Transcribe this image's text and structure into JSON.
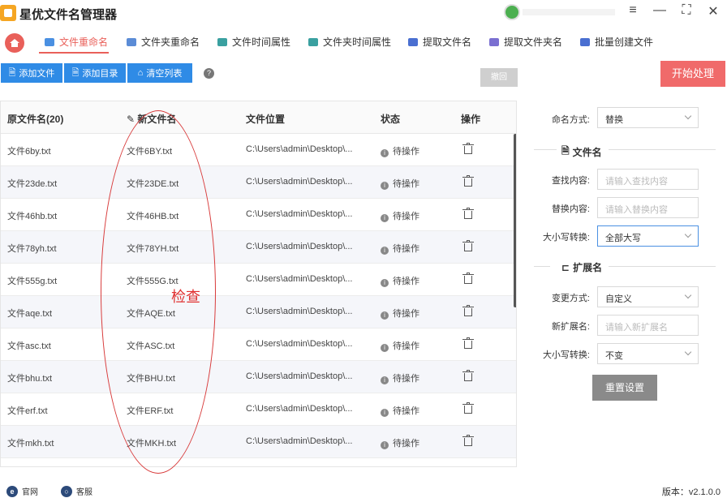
{
  "app": {
    "title": "星优文件名管理器"
  },
  "window": {
    "minimize": "—",
    "restore": "⛶",
    "close": "✕",
    "settings": "≡"
  },
  "tabs": [
    {
      "label": "文件重命名",
      "color": "#4a90e2"
    },
    {
      "label": "文件夹重命名",
      "color": "#5b8cd6"
    },
    {
      "label": "文件时间属性",
      "color": "#3aa0a0"
    },
    {
      "label": "文件夹时间属性",
      "color": "#3aa0a0"
    },
    {
      "label": "提取文件名",
      "color": "#4a6fd1"
    },
    {
      "label": "提取文件夹名",
      "color": "#7a6fd1"
    },
    {
      "label": "批量创建文件",
      "color": "#4a6fd1"
    }
  ],
  "toolbar": {
    "add_file": "添加文件",
    "add_dir": "添加目录",
    "clear_list": "清空列表",
    "help": "?",
    "undo": "撤回",
    "start": "开始处理"
  },
  "table": {
    "headers": {
      "orig": "原文件名(20)",
      "new": "新文件名",
      "location": "文件位置",
      "status": "状态",
      "action": "操作"
    },
    "rows": [
      {
        "orig": "文件6by.txt",
        "new": "文件6BY.txt",
        "loc": "C:\\Users\\admin\\Desktop\\...",
        "status": "待操作"
      },
      {
        "orig": "文件23de.txt",
        "new": "文件23DE.txt",
        "loc": "C:\\Users\\admin\\Desktop\\...",
        "status": "待操作"
      },
      {
        "orig": "文件46hb.txt",
        "new": "文件46HB.txt",
        "loc": "C:\\Users\\admin\\Desktop\\...",
        "status": "待操作"
      },
      {
        "orig": "文件78yh.txt",
        "new": "文件78YH.txt",
        "loc": "C:\\Users\\admin\\Desktop\\...",
        "status": "待操作"
      },
      {
        "orig": "文件555g.txt",
        "new": "文件555G.txt",
        "loc": "C:\\Users\\admin\\Desktop\\...",
        "status": "待操作"
      },
      {
        "orig": "文件aqe.txt",
        "new": "文件AQE.txt",
        "loc": "C:\\Users\\admin\\Desktop\\...",
        "status": "待操作"
      },
      {
        "orig": "文件asc.txt",
        "new": "文件ASC.txt",
        "loc": "C:\\Users\\admin\\Desktop\\...",
        "status": "待操作"
      },
      {
        "orig": "文件bhu.txt",
        "new": "文件BHU.txt",
        "loc": "C:\\Users\\admin\\Desktop\\...",
        "status": "待操作"
      },
      {
        "orig": "文件erf.txt",
        "new": "文件ERF.txt",
        "loc": "C:\\Users\\admin\\Desktop\\...",
        "status": "待操作"
      },
      {
        "orig": "文件mkh.txt",
        "new": "文件MKH.txt",
        "loc": "C:\\Users\\admin\\Desktop\\...",
        "status": "待操作"
      }
    ]
  },
  "annotation": {
    "label": "检查"
  },
  "panel": {
    "naming_label": "命名方式:",
    "naming_value": "替换",
    "filename_section": "文件名",
    "find_label": "查找内容:",
    "find_placeholder": "请输入查找内容",
    "replace_label": "替换内容:",
    "replace_placeholder": "请输入替换内容",
    "case_label": "大小写转换:",
    "case_value": "全部大写",
    "ext_section": "扩展名",
    "ext_mode_label": "变更方式:",
    "ext_mode_value": "自定义",
    "new_ext_label": "新扩展名:",
    "new_ext_placeholder": "请输入新扩展名",
    "ext_case_label": "大小写转换:",
    "ext_case_value": "不变",
    "reset": "重置设置"
  },
  "footer": {
    "website": "官网",
    "support": "客服",
    "version": "版本：v2.1.0.0"
  }
}
